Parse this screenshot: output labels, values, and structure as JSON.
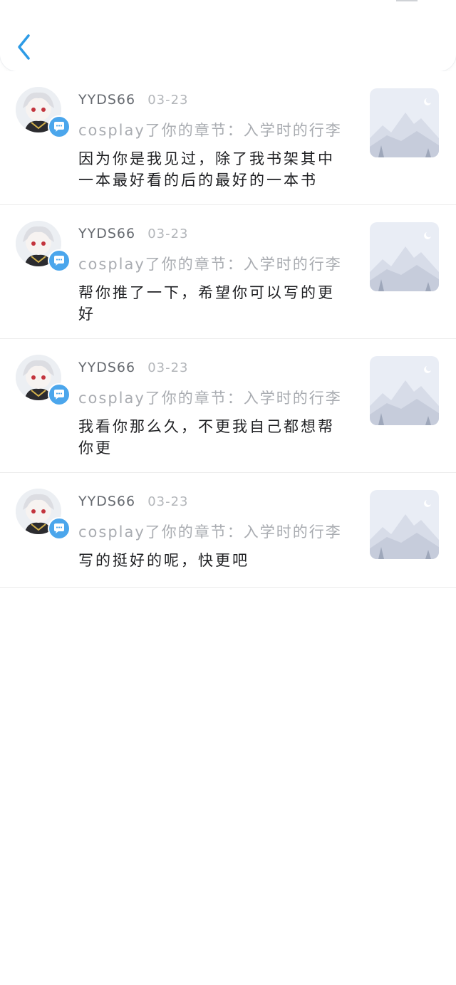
{
  "header": {
    "back_icon": "chevron-left-icon",
    "accent_color": "#2d9be6"
  },
  "messages": [
    {
      "username": "YYDS66",
      "date": "03-23",
      "chapter": "cosplay了你的章节：入学时的行李",
      "comment": "因为你是我见过，除了我书架其中一本最好看的后的最好的一本书",
      "badge_icon": "chat-bubble-icon"
    },
    {
      "username": "YYDS66",
      "date": "03-23",
      "chapter": "cosplay了你的章节：入学时的行李",
      "comment": "帮你推了一下，希望你可以写的更好",
      "badge_icon": "chat-bubble-icon"
    },
    {
      "username": "YYDS66",
      "date": "03-23",
      "chapter": "cosplay了你的章节：入学时的行李",
      "comment": "我看你那么久，不更我自己都想帮你更",
      "badge_icon": "chat-bubble-icon"
    },
    {
      "username": "YYDS66",
      "date": "03-23",
      "chapter": "cosplay了你的章节：入学时的行李",
      "comment": "写的挺好的呢，快更吧",
      "badge_icon": "chat-bubble-icon"
    }
  ]
}
